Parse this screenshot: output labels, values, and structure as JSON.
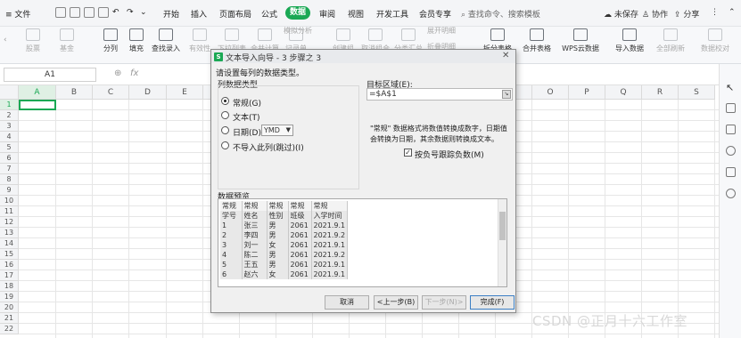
{
  "menubar": {
    "file_menu": "≡ 文件",
    "tabs": [
      "开始",
      "插入",
      "页面布局",
      "公式",
      "数据",
      "审阅",
      "视图",
      "开发工具",
      "会员专享"
    ],
    "active_tab": "数据",
    "search": "查找命令、搜索模板",
    "unsaved": "未保存",
    "collab": "协作",
    "share": "分享"
  },
  "ribbon": {
    "buttons": [
      "股票",
      "基金",
      "分列",
      "填充",
      "查找录入",
      "有效性",
      "下拉列表",
      "合并计算",
      "记录单",
      "创建组",
      "取消组合",
      "分类汇总",
      "展开明细",
      "折叠明细",
      "拆分表格",
      "合并表格",
      "WPS云数据",
      "导入数据",
      "全部刷新",
      "数据校对"
    ],
    "simulate": "模拟分析"
  },
  "formulabar": {
    "namebox": "A1",
    "fx": "fx"
  },
  "grid": {
    "columns": [
      "A",
      "B",
      "C",
      "D",
      "E",
      "F",
      "G",
      "H",
      "I",
      "J",
      "K",
      "L",
      "M",
      "N",
      "O",
      "P",
      "Q",
      "R",
      "S"
    ],
    "rows": [
      "1",
      "2",
      "3",
      "4",
      "5",
      "6",
      "7",
      "8",
      "9",
      "10",
      "11",
      "12",
      "13",
      "14",
      "15",
      "16",
      "17",
      "18",
      "19",
      "20",
      "21",
      "22"
    ],
    "selected_cell": "A1"
  },
  "dialog": {
    "title": "文本导入向导 - 3 步骤之 3",
    "instruction": "请设置每列的数据类型。",
    "column_type_label": "列数据类型",
    "options": [
      "常规(G)",
      "文本(T)",
      "日期(D)",
      "不导入此列(跳过)(I)"
    ],
    "selected_option": "常规(G)",
    "date_format": "YMD",
    "target_label": "目标区域(E):",
    "target_value": "=$A$1",
    "hint_line1": "\"常规\" 数据格式将数值转换成数字，日期值",
    "hint_line2": "会转换为日期，其余数据则转换成文本。",
    "checkbox_label": "按负号跟踪负数(M)",
    "checkbox_checked": true,
    "preview_label": "数据预览",
    "preview_headers": [
      "常规",
      "常规",
      "常规",
      "常规",
      "常规"
    ],
    "preview_rows": [
      [
        "学号",
        "姓名",
        "性别",
        "班级",
        "入学时间"
      ],
      [
        "1",
        "张三",
        "男",
        "2061",
        "2021.9.1"
      ],
      [
        "2",
        "李四",
        "男",
        "2061",
        "2021.9.2"
      ],
      [
        "3",
        "刘一",
        "女",
        "2061",
        "2021.9.1"
      ],
      [
        "4",
        "陈二",
        "男",
        "2061",
        "2021.9.2"
      ],
      [
        "5",
        "王五",
        "男",
        "2061",
        "2021.9.1"
      ],
      [
        "6",
        "赵六",
        "女",
        "2061",
        "2021.9.1"
      ]
    ],
    "buttons": {
      "cancel": "取消",
      "back": "<上一步(B)",
      "next": "下一步(N)>",
      "finish": "完成(F)"
    }
  },
  "watermark": "CSDN @正月十六工作室"
}
